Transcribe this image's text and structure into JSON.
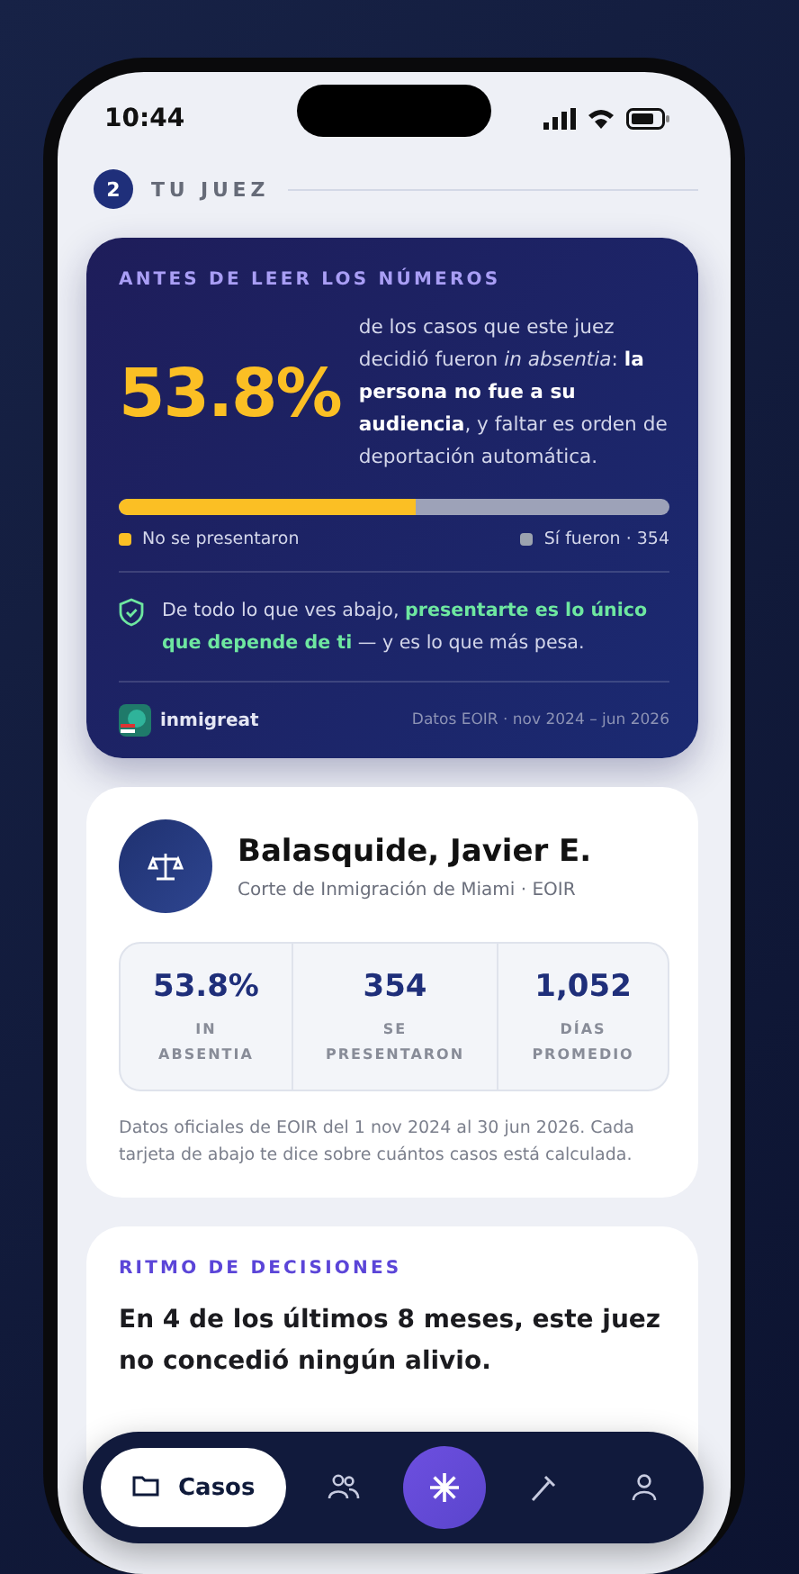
{
  "status_bar": {
    "time": "10:44"
  },
  "section": {
    "number": "2",
    "title": "TU JUEZ"
  },
  "intro_card": {
    "eyebrow": "ANTES DE LEER LOS NÚMEROS",
    "big_figure": "53.8%",
    "explanation": "de los casos que este juez decidió fueron *in absentia*: **la persona no fue a su audiencia**, y faltar es orden de deportación automática.",
    "bar": {
      "level": 0.538
    },
    "legend": [
      {
        "label": "No se presentaron",
        "color": "#fbbf24"
      },
      {
        "label": "Sí fueron · 354",
        "color": "#9ca3af"
      }
    ],
    "note": "De todo lo que ves abajo, **presentarte es lo único que depende de ti** — y es lo que más pesa.",
    "brand": "inmigreat",
    "source": "Datos EOIR · nov 2024 – jun 2026"
  },
  "judge_card": {
    "name": "Balasquide, Javier E.",
    "court": "Corte de Inmigración de Miami · EOIR",
    "stats": [
      {
        "value": "53.8%",
        "label": "IN ABSENTIA"
      },
      {
        "value": "354",
        "label": "SE PRESENTARON"
      },
      {
        "value": "1,052",
        "label": "DÍAS PROMEDIO"
      }
    ],
    "footnote": "Datos oficiales de EOIR del 1 nov 2024 al 30 jun 2026. Cada tarjeta de abajo te dice sobre cuántos casos está calculada."
  },
  "rhythm_card": {
    "eyebrow": "RITMO DE DECISIONES",
    "headline": "En 4 de los últimos 8 meses, este juez no concedió ningún alivio."
  },
  "nav": [
    {
      "kind": "tab",
      "label": "Casos",
      "selected": true
    },
    {
      "kind": "tab",
      "selected": false
    },
    {
      "kind": "action"
    },
    {
      "kind": "tab",
      "selected": false
    },
    {
      "kind": "tab",
      "selected": false
    }
  ]
}
